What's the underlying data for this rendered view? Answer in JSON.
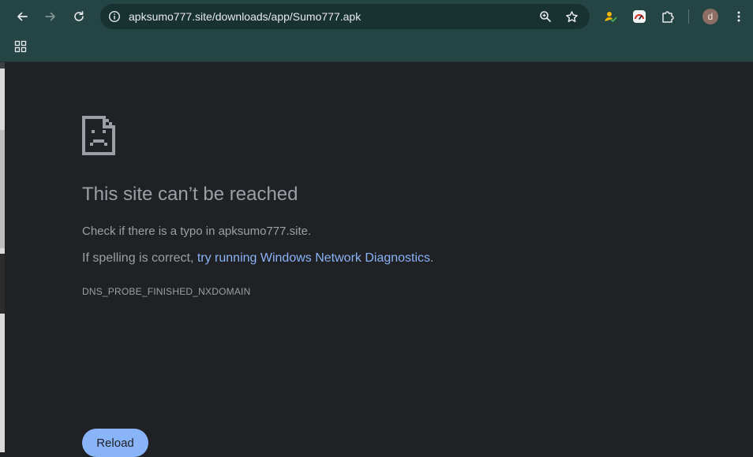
{
  "browser": {
    "url": "apksumo777.site/downloads/app/Sumo777.apk",
    "avatar_letter": "d",
    "icons": [
      "back-icon",
      "forward-icon",
      "reload-icon",
      "site-info-icon",
      "zoom-icon",
      "bookmark-star-icon",
      "extension-person-icon",
      "extension-speed-icon",
      "extensions-puzzle-icon",
      "menu-kebab-icon",
      "apps-grid-icon"
    ]
  },
  "error_page": {
    "title": "This site can’t be reached",
    "check_text": "Check if there is a typo in apksumo777.site.",
    "spelling_prefix": "If spelling is correct, ",
    "diagnostics_link": "try running Windows Network Diagnostics",
    "spelling_suffix": ".",
    "error_code": "DNS_PROBE_FINISHED_NXDOMAIN",
    "reload_label": "Reload"
  },
  "colors": {
    "toolbar": "#254545",
    "page_bg": "#202124",
    "text": "#9aa0a6",
    "link": "#8ab4f8",
    "button": "#8ab4f8"
  }
}
